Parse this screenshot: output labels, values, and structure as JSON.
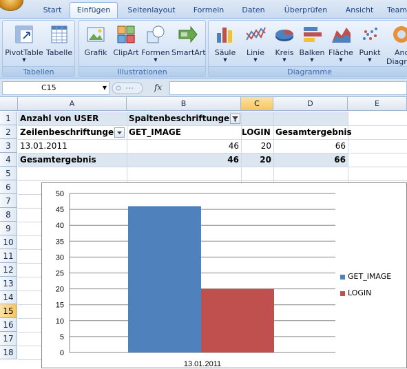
{
  "tabs": [
    {
      "label": "Start",
      "active": false
    },
    {
      "label": "Einfügen",
      "active": true
    },
    {
      "label": "Seitenlayout",
      "active": false
    },
    {
      "label": "Formeln",
      "active": false
    },
    {
      "label": "Daten",
      "active": false
    },
    {
      "label": "Überprüfen",
      "active": false
    },
    {
      "label": "Ansicht",
      "active": false
    },
    {
      "label": "Team",
      "active": false
    }
  ],
  "ribbon": {
    "groups": {
      "tabellen": "Tabellen",
      "illustrationen": "Illustrationen",
      "diagramme": "Diagramme"
    },
    "buttons": {
      "pivottable": "PivotTable",
      "tabelle": "Tabelle",
      "grafik": "Grafik",
      "clipart": "ClipArt",
      "formen": "Formen",
      "smartart": "SmartArt",
      "saeule": "Säule",
      "linie": "Linie",
      "kreis": "Kreis",
      "balken": "Balken",
      "flaeche": "Fläche",
      "punkt": "Punkt",
      "andere_1": "And",
      "andere_2": "Diagra"
    }
  },
  "formula_bar": {
    "name_box": "C15",
    "fx_label": "fx",
    "formula": ""
  },
  "grid": {
    "columns": [
      "A",
      "B",
      "C",
      "D",
      "E"
    ],
    "selected_column": "C",
    "rows": [
      "1",
      "2",
      "3",
      "4",
      "5",
      "6",
      "7",
      "8",
      "9",
      "10",
      "11",
      "12",
      "13",
      "14",
      "15",
      "16",
      "17",
      "18"
    ],
    "selected_row": "15",
    "cells": {
      "a1": "Anzahl von USER",
      "b1": "Spaltenbeschriftungen",
      "a2": "Zeilenbeschriftungen",
      "b2": "GET_IMAGE",
      "c2": "LOGIN",
      "d2": "Gesamtergebnis",
      "a3": "13.01.2011",
      "b3": "46",
      "c3": "20",
      "d3": "66",
      "a4": "Gesamtergebnis",
      "b4": "46",
      "c4": "20",
      "d4": "66"
    }
  },
  "colors": {
    "get_image": "#4f81bd",
    "login": "#c0504d",
    "selection": "#f6c55c",
    "pivot_band": "#dce6f1"
  },
  "chart_data": {
    "type": "bar",
    "categories": [
      "13.01.2011"
    ],
    "series": [
      {
        "name": "GET_IMAGE",
        "values": [
          46
        ],
        "color": "#4f81bd"
      },
      {
        "name": "LOGIN",
        "values": [
          20
        ],
        "color": "#c0504d"
      }
    ],
    "ylim": [
      0,
      50
    ],
    "yticks": [
      "0",
      "5",
      "10",
      "15",
      "20",
      "25",
      "30",
      "35",
      "40",
      "45",
      "50"
    ],
    "grid": true,
    "legend_position": "right"
  }
}
